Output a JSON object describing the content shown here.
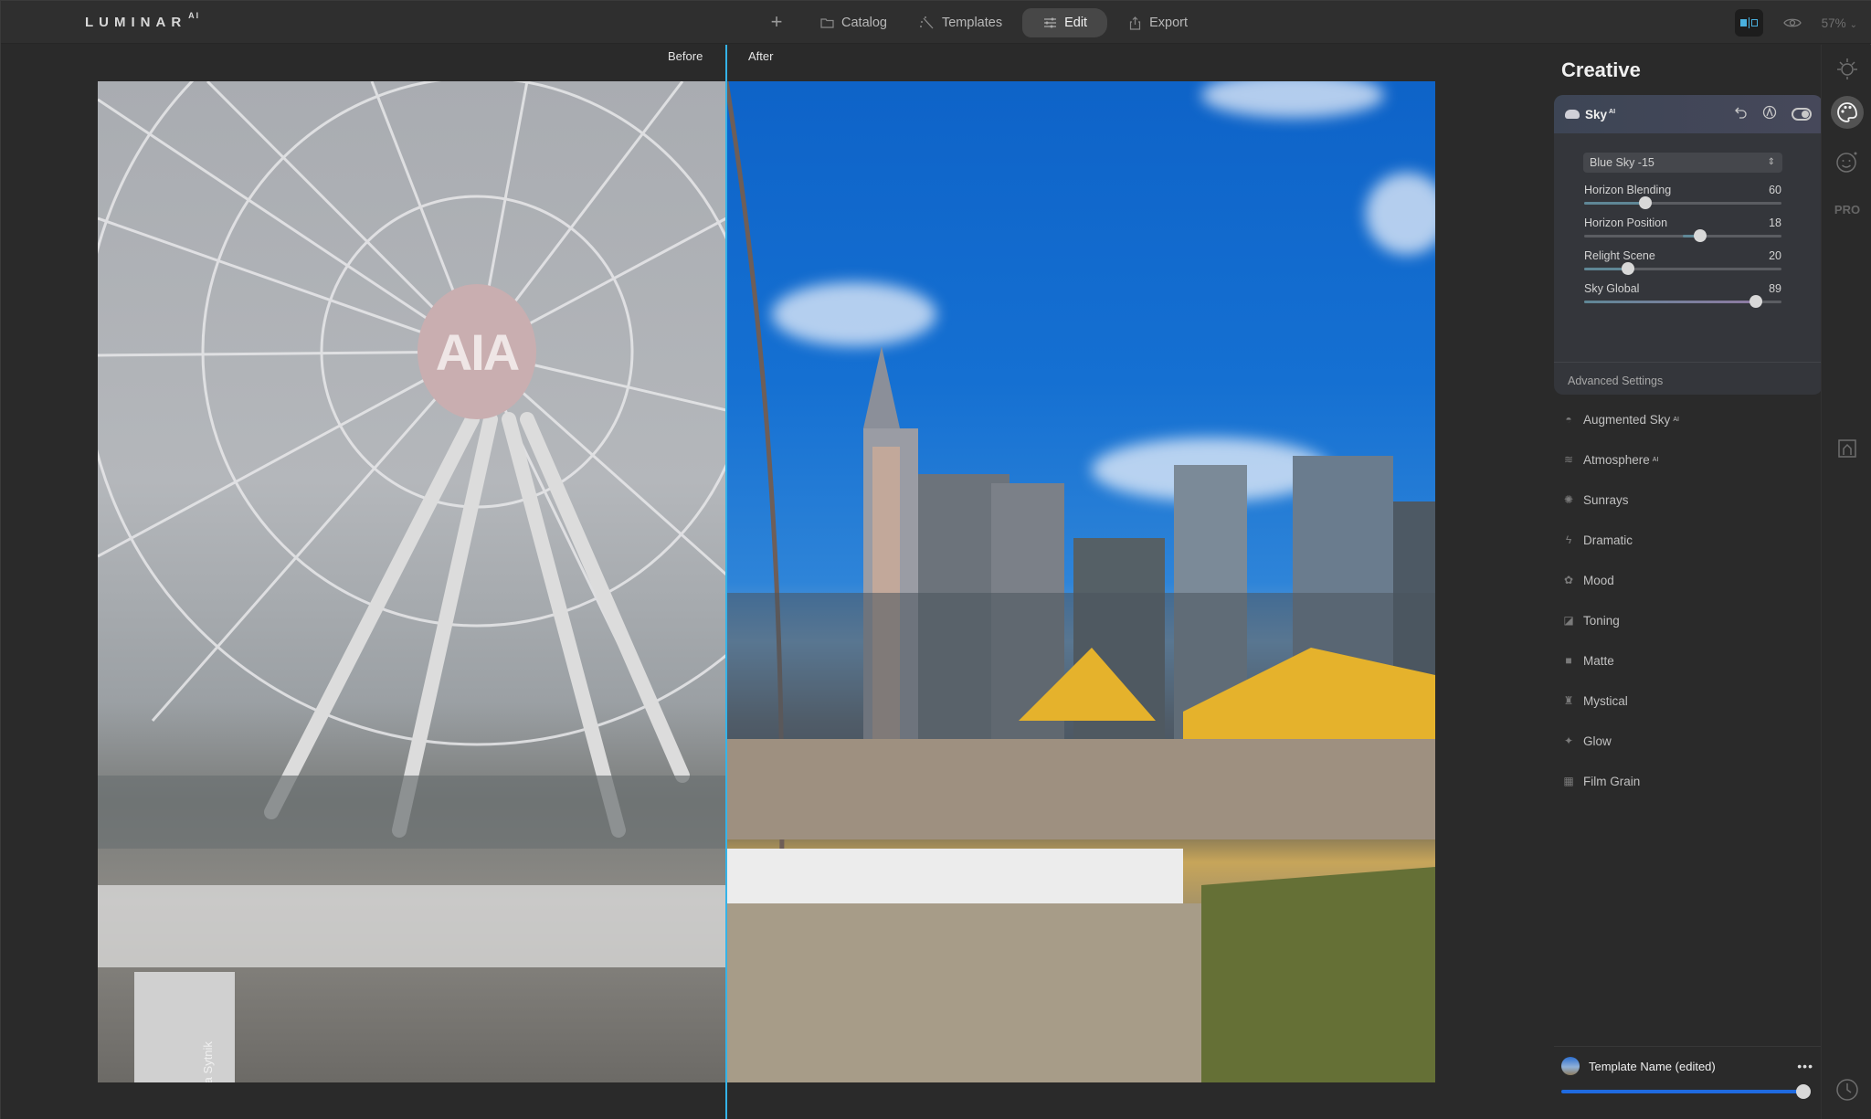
{
  "app": {
    "name": "LUMINAR",
    "name_suffix": "AI"
  },
  "nav": {
    "add_label": "+",
    "items": [
      {
        "label": "Catalog",
        "icon": "folder-icon"
      },
      {
        "label": "Templates",
        "icon": "magic-wand-icon"
      },
      {
        "label": "Edit",
        "icon": "sliders-icon",
        "active": true
      },
      {
        "label": "Export",
        "icon": "share-icon"
      }
    ]
  },
  "toolbar": {
    "zoom_level": "57%",
    "compare_mode": "split",
    "accent": "#4ab1df"
  },
  "canvas": {
    "before_label": "Before",
    "after_label": "After",
    "credit": "©Dima Sytnik",
    "divider_color": "#35b3e8",
    "hub_text": "AIA"
  },
  "panel": {
    "title": "Creative",
    "sky": {
      "name": "Sky",
      "badge": "AI",
      "preset": "Blue Sky -15",
      "sliders": [
        {
          "label": "Horizon Blending",
          "value": 60,
          "fraction": 0.31,
          "origin": "left"
        },
        {
          "label": "Horizon Position",
          "value": 18,
          "fraction": 0.59,
          "origin": "center"
        },
        {
          "label": "Relight Scene",
          "value": 20,
          "fraction": 0.22,
          "origin": "left"
        },
        {
          "label": "Sky Global",
          "value": 89,
          "fraction": 0.87,
          "origin": "left"
        }
      ],
      "advanced_label": "Advanced Settings"
    },
    "tools": [
      {
        "label": "Augmented Sky",
        "badge": "AI",
        "icon": "dome-icon"
      },
      {
        "label": "Atmosphere",
        "badge": "AI",
        "icon": "waves-icon"
      },
      {
        "label": "Sunrays",
        "badge": "",
        "icon": "sun-rays-icon"
      },
      {
        "label": "Dramatic",
        "badge": "",
        "icon": "lightning-icon"
      },
      {
        "label": "Mood",
        "badge": "",
        "icon": "flower-icon"
      },
      {
        "label": "Toning",
        "badge": "",
        "icon": "paint-bucket-icon"
      },
      {
        "label": "Matte",
        "badge": "",
        "icon": "matte-square-icon"
      },
      {
        "label": "Mystical",
        "badge": "",
        "icon": "mystical-icon"
      },
      {
        "label": "Glow",
        "badge": "",
        "icon": "sparkle-icon"
      },
      {
        "label": "Film Grain",
        "badge": "",
        "icon": "film-grain-icon"
      }
    ],
    "template": {
      "name": "Template Name (edited)",
      "more": "•••",
      "amount_fraction": 1.0
    }
  },
  "rail": {
    "pro_label": "PRO"
  }
}
